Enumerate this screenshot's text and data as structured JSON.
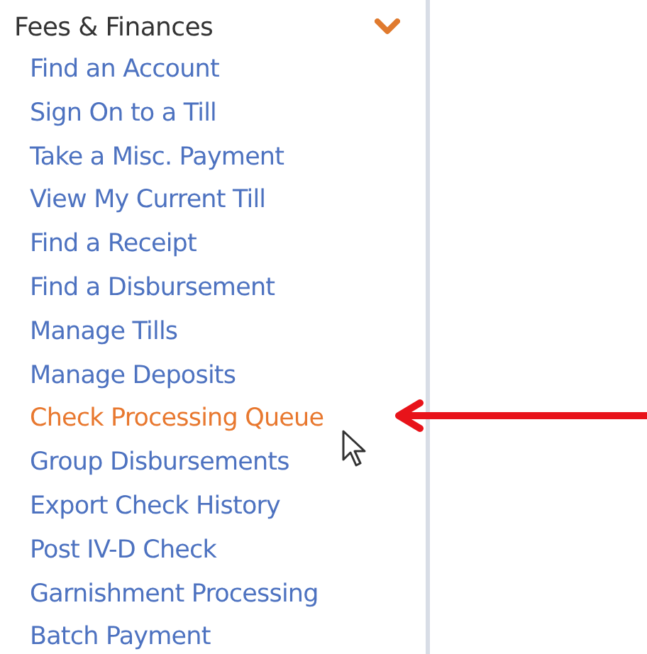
{
  "sidebar": {
    "title": "Fees & Finances",
    "expanded": true,
    "items": [
      {
        "label": "Find an Account",
        "selected": false
      },
      {
        "label": "Sign On to a Till",
        "selected": false
      },
      {
        "label": "Take a Misc. Payment",
        "selected": false
      },
      {
        "label": "View My Current Till",
        "selected": false
      },
      {
        "label": "Find a Receipt",
        "selected": false
      },
      {
        "label": "Find a Disbursement",
        "selected": false
      },
      {
        "label": "Manage Tills",
        "selected": false
      },
      {
        "label": "Manage Deposits",
        "selected": false
      },
      {
        "label": "Check Processing Queue",
        "selected": true
      },
      {
        "label": "Group Disbursements",
        "selected": false
      },
      {
        "label": "Export Check History",
        "selected": false
      },
      {
        "label": "Post IV-D Check",
        "selected": false
      },
      {
        "label": "Garnishment Processing",
        "selected": false
      },
      {
        "label": "Batch Payment",
        "selected": false
      }
    ]
  }
}
